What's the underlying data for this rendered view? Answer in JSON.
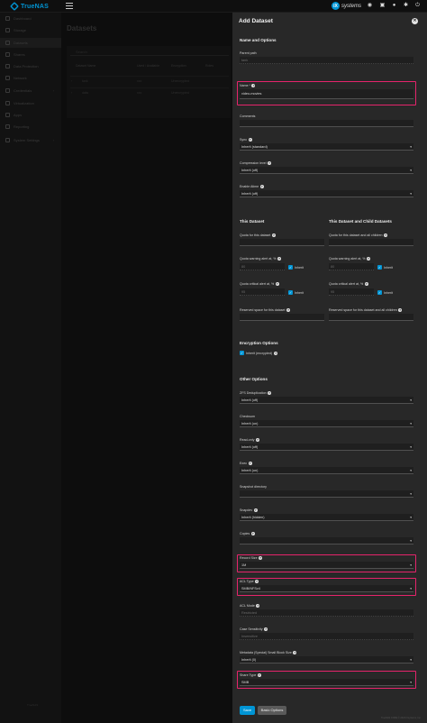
{
  "app": {
    "logo_text": "TrueNAS",
    "brand": "systems",
    "brand_mark": "iX"
  },
  "sidebar": {
    "items": [
      {
        "label": "Dashboard",
        "icon": "dashboard-icon"
      },
      {
        "label": "Storage",
        "icon": "storage-icon"
      },
      {
        "label": "Datasets",
        "icon": "datasets-icon",
        "active": true
      },
      {
        "label": "Shares",
        "icon": "shares-icon"
      },
      {
        "label": "Data Protection",
        "icon": "shield-icon"
      },
      {
        "label": "Network",
        "icon": "network-icon"
      },
      {
        "label": "Credentials",
        "icon": "key-icon",
        "arrow": true
      },
      {
        "label": "Virtualization",
        "icon": "monitor-icon"
      },
      {
        "label": "Apps",
        "icon": "apps-icon"
      },
      {
        "label": "Reporting",
        "icon": "chart-icon"
      },
      {
        "label": "System Settings",
        "icon": "gear-icon",
        "arrow": true
      }
    ],
    "footer": "TrueNAS"
  },
  "main": {
    "title": "Datasets",
    "search_placeholder": "Search",
    "columns": [
      "Dataset Name",
      "Used / Available",
      "Encryption",
      "Roles"
    ],
    "rows": [
      {
        "name": "tank",
        "used": "xxx",
        "encryption": "Unencrypted"
      },
      {
        "name": "data",
        "used": "xxx",
        "encryption": "Unencrypted"
      }
    ]
  },
  "panel": {
    "title": "Add Dataset",
    "close_symbol": "✕",
    "section_name": "Name and Options",
    "parent_path_label": "Parent path",
    "parent_path_value": "tank",
    "name_label": "Name *",
    "name_value": "video-movies",
    "comments_label": "Comments",
    "comments_value": "",
    "sync_label": "Sync",
    "sync_value": "Inherit (standard)",
    "compression_label": "Compression level",
    "compression_value": "Inherit (off)",
    "atime_label": "Enable Atime",
    "atime_value": "Inherit (off)",
    "this_dataset_title": "This Dataset",
    "child_datasets_title": "This Dataset and Child Datasets",
    "quota_this_label": "Quota for this dataset",
    "quota_child_label": "Quota for this dataset and all children",
    "quota_warn_label": "Quota warning alert at, %",
    "quota_warn_value": "80",
    "quota_crit_label": "Quota critical alert at, %",
    "quota_crit_value": "95",
    "inherit_label": "Inherit",
    "reserved_this_label": "Reserved space for this dataset",
    "reserved_child_label": "Reserved space for this dataset and all children",
    "encryption_title": "Encryption Options",
    "encryption_inherit_label": "Inherit (encrypted)",
    "other_title": "Other Options",
    "zfs_dedup_label": "ZFS Deduplication",
    "zfs_dedup_value": "Inherit (off)",
    "checksum_label": "Checksum",
    "checksum_value": "Inherit (on)",
    "readonly_label": "Read-only",
    "readonly_value": "Inherit (off)",
    "exec_label": "Exec",
    "exec_value": "Inherit (on)",
    "snapdir_label": "Snapshot directory",
    "snapdir_value": "",
    "snapdev_label": "Snapdev",
    "snapdev_value": "Inherit (hidden)",
    "copies_label": "Copies",
    "copies_value": "",
    "record_size_label": "Record Size",
    "record_size_value": "1M",
    "acl_type_label": "ACL Type",
    "acl_type_value": "SMB/NFSv4",
    "acl_mode_label": "ACL Mode",
    "acl_mode_value": "Restricted",
    "case_label": "Case Sensitivity",
    "case_value": "Insensitive",
    "metadata_label": "Metadata (Special) Small Block Size",
    "metadata_value": "Inherit (0)",
    "share_type_label": "Share Type",
    "share_type_value": "SMB",
    "save_label": "Save",
    "basic_label": "Basic Options"
  },
  "footer_note": "TrueNAS CORE © 2023 iXsystems, Inc.",
  "colors": {
    "accent": "#0095d5",
    "highlight": "#e5246b",
    "panel_bg": "#282828"
  }
}
